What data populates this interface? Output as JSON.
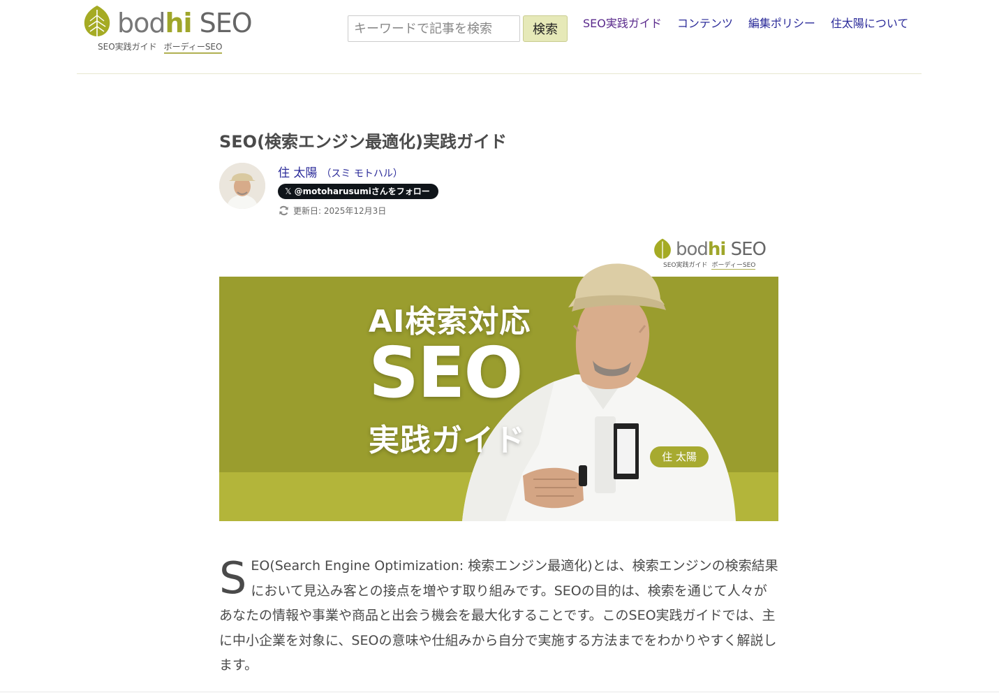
{
  "brand": {
    "logo_part1": "bod",
    "logo_part2": "hi",
    "logo_part3": " SEO",
    "tagline_1": "SEO実践ガイド",
    "tagline_2": "ボーディーSEO",
    "accent_color": "#9fa62a"
  },
  "search": {
    "placeholder": "キーワードで記事を検索",
    "button_label": "検索"
  },
  "nav": {
    "items": [
      {
        "label": "SEO実践ガイド"
      },
      {
        "label": "コンテンツ"
      },
      {
        "label": "編集ポリシー"
      },
      {
        "label": "住太陽について"
      }
    ]
  },
  "article": {
    "title": "SEO(検索エンジン最適化)実践ガイド",
    "author_name": "住 太陽",
    "author_kana": "（スミ モトハル）",
    "follow_label": "@motoharusumiさんをフォロー",
    "follow_icon": "x-logo-icon",
    "updated": "更新日: 2025年12月3日",
    "hero": {
      "line1": "AI検索対応",
      "line2": "SEO",
      "line3": "実践ガイド",
      "name_pill": "住 太陽",
      "band_color": "#9a9d2e"
    },
    "dropcap": "S",
    "lead": "EO(Search Engine Optimization: 検索エンジン最適化)とは、検索エンジンの検索結果において見込み客との接点を増やす取り組みです。SEOの目的は、検索を通じて人々があなたの情報や事業や商品と出会う機会を最大化することです。このSEO実践ガイドでは、主に中小企業を対象に、SEOの意味や仕組みから自分で実施する方法までをわかりやすく解説します。"
  }
}
